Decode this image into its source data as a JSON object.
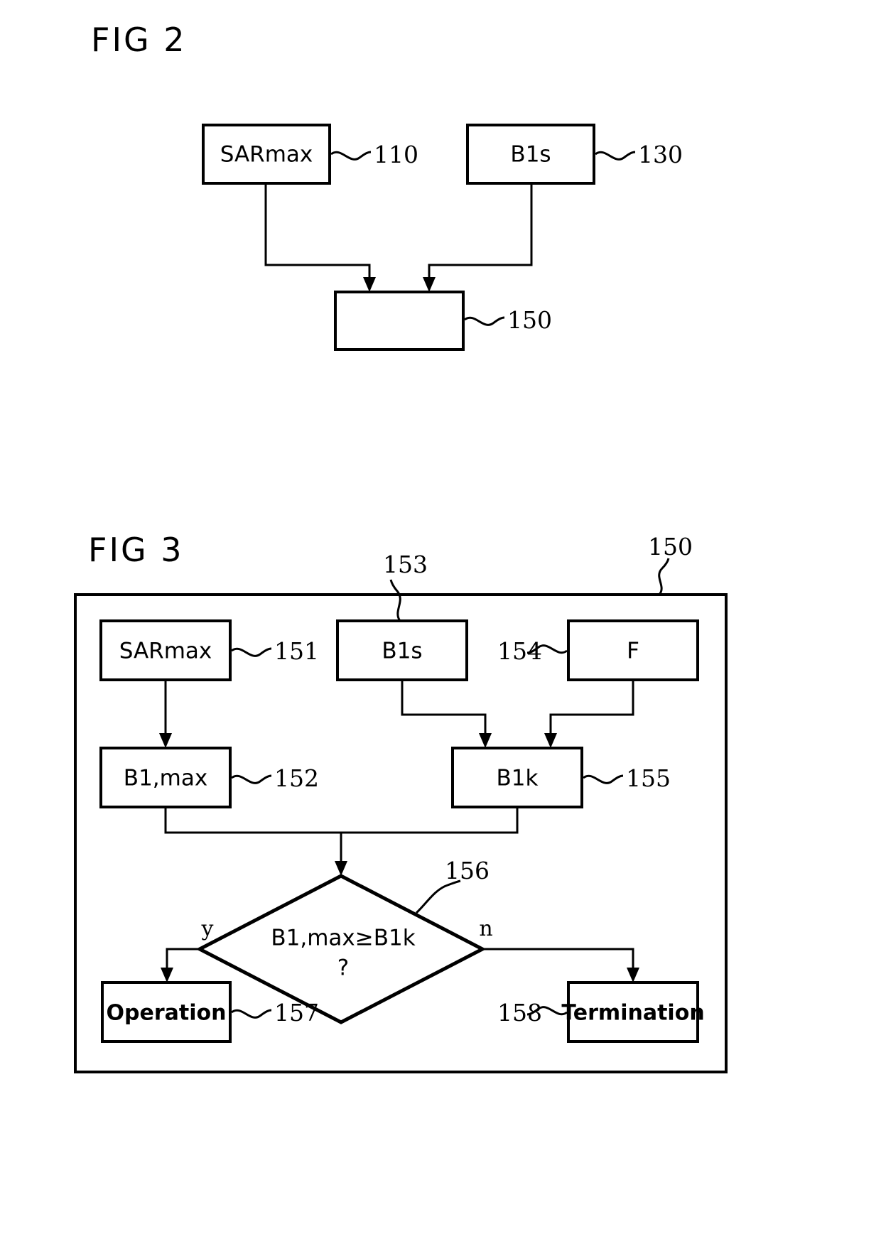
{
  "document": {
    "type": "patent-figure-sheet",
    "background_color": "#ffffff",
    "ink_color": "#000000"
  },
  "figures": [
    {
      "id": "fig2",
      "title": "FIG  2",
      "nodes": [
        {
          "id": "f2-110",
          "label": "SARmax",
          "ref": "110"
        },
        {
          "id": "f2-130",
          "label": "B1s",
          "ref": "130"
        },
        {
          "id": "f2-150",
          "label": "",
          "ref": "150"
        }
      ]
    },
    {
      "id": "fig3",
      "title": "FIG  3",
      "container_ref": "150",
      "nodes": [
        {
          "id": "f3-151",
          "label": "SARmax",
          "ref": "151"
        },
        {
          "id": "f3-153",
          "label": "B1s",
          "ref": "153"
        },
        {
          "id": "f3-154",
          "label": "F",
          "ref": "154"
        },
        {
          "id": "f3-152",
          "label": "B1,max",
          "ref": "152"
        },
        {
          "id": "f3-155",
          "label": "B1k",
          "ref": "155"
        },
        {
          "id": "f3-156",
          "label_line1": "B1,max≥B1k",
          "label_line2": "?",
          "ref": "156"
        },
        {
          "id": "f3-157",
          "label": "Operation",
          "ref": "157"
        },
        {
          "id": "f3-158",
          "label": "Termination",
          "ref": "158"
        }
      ],
      "branches": [
        {
          "id": "yes",
          "label": "y"
        },
        {
          "id": "no",
          "label": "n"
        }
      ]
    }
  ]
}
